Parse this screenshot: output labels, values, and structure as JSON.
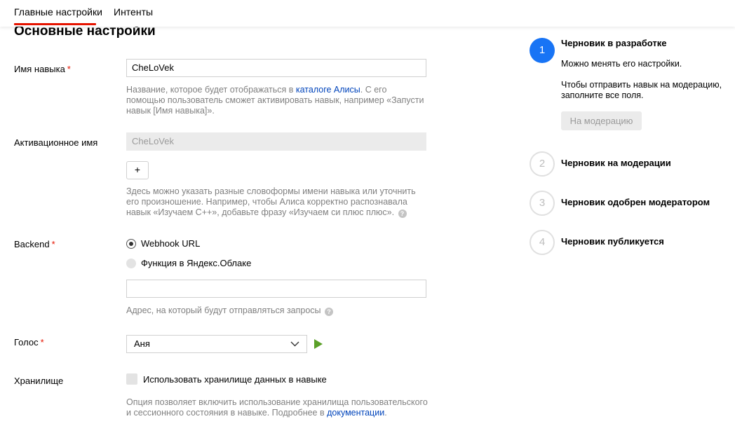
{
  "tabs": {
    "main": "Главные настройки",
    "intents": "Интенты"
  },
  "section_title": "Основные настройки",
  "skill_name": {
    "label": "Имя навыка",
    "required_mark": "*",
    "value": "CheLoVek",
    "hint_before": "Название, которое будет отображаться в ",
    "hint_link": "каталоге Алисы",
    "hint_after": ". С его помощью пользователь сможет активировать навык, например «Запусти навык [Имя навыка]»."
  },
  "activation_name": {
    "label": "Активационное имя",
    "value": "CheLoVek",
    "add_button": "+",
    "hint": "Здесь можно указать разные словоформы имени навыка или уточнить его произношение. Например, чтобы Алиса корректно распознавала навык «Изучаем С++», добавьте фразу «Изучаем си плюс плюс».",
    "help_icon": "?"
  },
  "backend": {
    "label": "Backend",
    "required_mark": "*",
    "options": [
      "Webhook URL",
      "Функция в Яндекс.Облаке"
    ],
    "selected": "Webhook URL",
    "url_value": "",
    "hint": "Адрес, на который будут отправляться запросы",
    "help_icon": "?"
  },
  "voice": {
    "label": "Голос",
    "required_mark": "*",
    "selected": "Аня"
  },
  "storage": {
    "label": "Хранилище",
    "checkbox_label": "Использовать хранилище данных в навыке",
    "checked": false,
    "hint_before": "Опция позволяет включить использование хранилища пользовательского и сессионного состояния в навыке. Подробнее в ",
    "hint_link": "документации",
    "hint_after": "."
  },
  "status": {
    "steps": [
      {
        "number": "1",
        "title": "Черновик в разработке",
        "active": true
      },
      {
        "number": "2",
        "title": "Черновик на модерации",
        "active": false
      },
      {
        "number": "3",
        "title": "Черновик одобрен модератором",
        "active": false
      },
      {
        "number": "4",
        "title": "Черновик публикуется",
        "active": false
      }
    ],
    "active_text_1": "Можно менять его настройки.",
    "active_text_2": "Чтобы отправить навык на модерацию, заполните все поля.",
    "moderation_button": "На модерацию"
  },
  "colors": {
    "accent_red": "#e61400",
    "step_active": "#1874f5",
    "link": "#0044bb",
    "play_green": "#5aa028"
  }
}
